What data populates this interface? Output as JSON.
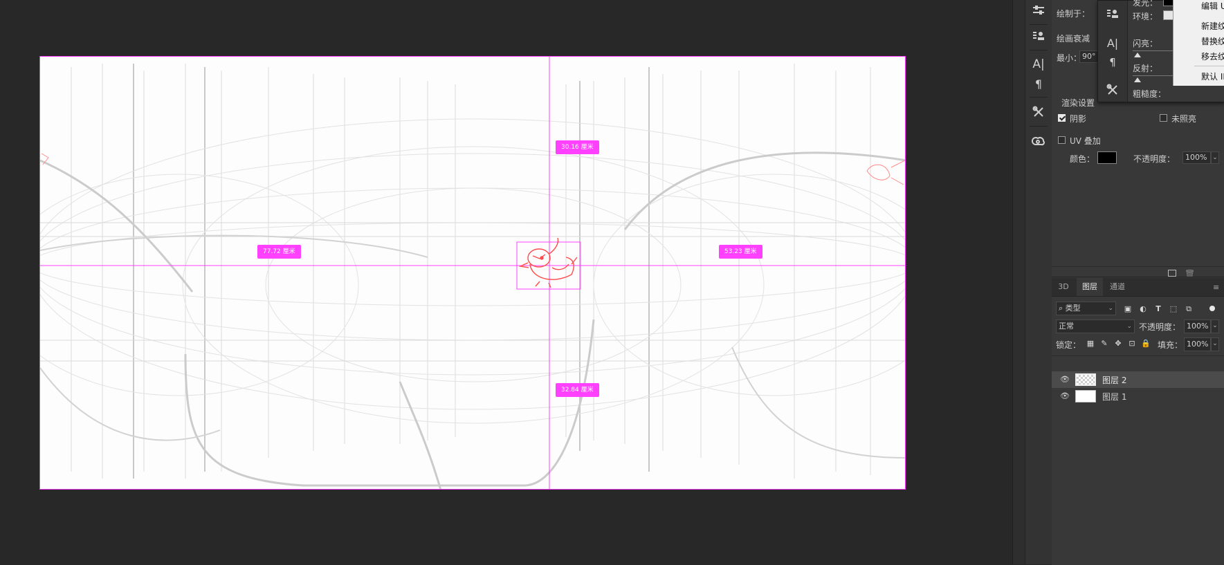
{
  "canvas": {
    "measurements": {
      "top": "30.16 厘米",
      "left": "77.72 厘米",
      "right": "53.23 厘米",
      "bottom": "32.84 厘米"
    },
    "guide_color": "#ff40ff"
  },
  "toolstrip": {
    "icons": [
      "properties-icon",
      "clone-source-icon",
      "character-icon",
      "paragraph-icon",
      "tools-icon",
      "creative-cloud-icon"
    ]
  },
  "flyout": {
    "glow_label": "发光：",
    "ambient_label": "环境：",
    "flash_label": "闪亮：",
    "reflect_label": "反射：",
    "rough_label": "粗糙度："
  },
  "context_menu": {
    "items": [
      "编辑 U",
      "新建纹",
      "替换纹",
      "移去纹",
      "默认 IB"
    ]
  },
  "properties": {
    "draw_on_label": "绘制于：",
    "paint_falloff_label": "绘画衰减",
    "min_label": "最小：",
    "min_value": "90°",
    "render_settings_label": "渲染设置",
    "shadow_label": "阴影",
    "shadow_checked": true,
    "unlit_label": "未照亮",
    "unlit_checked": false,
    "uv_overlay_label": "UV 叠加",
    "uv_overlay_checked": false,
    "color_label": "颜色：",
    "color_value": "#000000",
    "opacity_label": "不透明度：",
    "opacity_value": "100%"
  },
  "layers_panel": {
    "tabs": [
      "3D",
      "图层",
      "通道"
    ],
    "active_tab": "图层",
    "filter_label": "类型",
    "blend_mode": "正常",
    "opacity_label": "不透明度：",
    "opacity_value": "100%",
    "lock_label": "锁定：",
    "fill_label": "填充：",
    "fill_value": "100%",
    "layers": [
      {
        "name": "图层 2",
        "selected": true,
        "transparent": true
      },
      {
        "name": "图层 1",
        "selected": false,
        "transparent": false
      }
    ]
  }
}
